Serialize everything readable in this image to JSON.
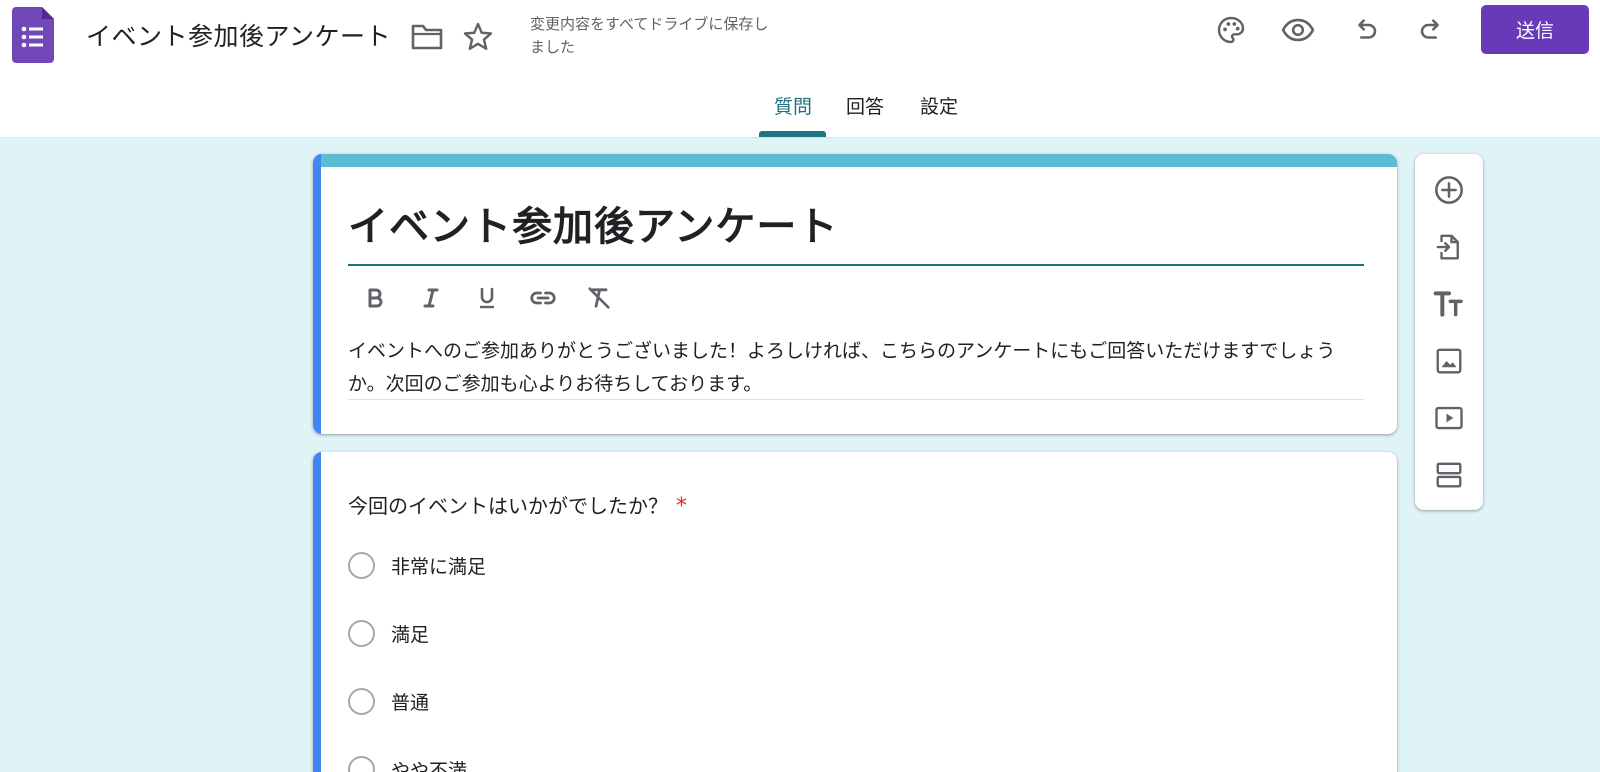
{
  "header": {
    "doc_title": "イベント参加後アンケート",
    "save_status": "変更内容をすべてドライブに保存しました",
    "send_label": "送信"
  },
  "tabs": [
    {
      "label": "質問",
      "active": true
    },
    {
      "label": "回答",
      "active": false
    },
    {
      "label": "設定",
      "active": false
    }
  ],
  "form": {
    "title": "イベント参加後アンケート",
    "description": "イベントへのご参加ありがとうございました！よろしければ、こちらのアンケートにもご回答いただけますでしょうか。次回のご参加も心よりお待ちしております。"
  },
  "question": {
    "title": "今回のイベントはいかがでしたか？",
    "required_mark": "*",
    "options": [
      "非常に満足",
      "満足",
      "普通",
      "やや不満"
    ]
  },
  "icons": {
    "app": "forms-logo-icon",
    "folder": "folder-icon",
    "star": "star-icon",
    "palette": "palette-icon",
    "preview": "eye-icon",
    "undo": "undo-icon",
    "redo": "redo-icon",
    "bold": "bold-icon",
    "italic": "italic-icon",
    "underline": "underline-icon",
    "link": "link-icon",
    "clear_format": "clear-format-icon",
    "add_question": "add-circle-icon",
    "import": "import-icon",
    "title_text": "text-icon",
    "image": "image-icon",
    "video": "video-icon",
    "section": "section-icon"
  },
  "colors": {
    "accent": "#673ab7",
    "theme": "#5bbcd4",
    "tab_active": "#1e6f80",
    "background": "#e0f3f7",
    "required": "#d93025"
  }
}
